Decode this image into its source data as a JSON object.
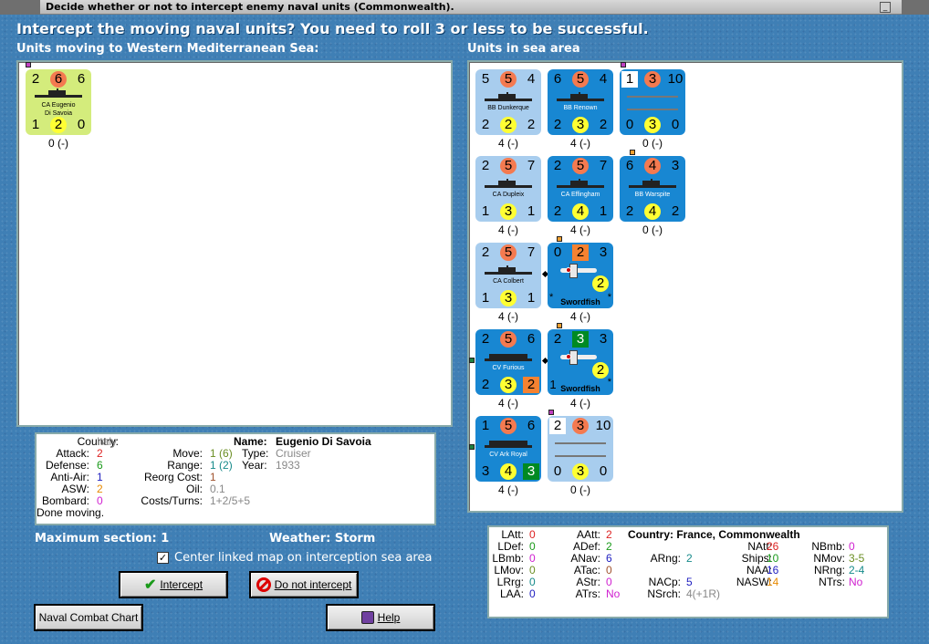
{
  "window": {
    "title": "Decide whether or not to intercept enemy naval units (Commonwealth)."
  },
  "heading": "Intercept the moving naval units?  You need to roll 3 or less to be successful.",
  "moving_label": "Units moving to Western Mediterranean Sea:",
  "sea_label": "Units in sea area",
  "moving_units": [
    {
      "name_line1": "CA Eugenio",
      "name_line2": "Di Savoia",
      "tl": "2",
      "tc": "6",
      "tr": "6",
      "bl": "1",
      "bc": "2",
      "br": "0",
      "under": "0 (-)"
    }
  ],
  "sea_units": [
    {
      "name": "BB Dunkerque",
      "tl": "5",
      "tc": "5",
      "tr": "4",
      "bl": "2",
      "bc": "2",
      "br": "2",
      "under": "4 (-)"
    },
    {
      "name": "BB Renown",
      "tl": "6",
      "tc": "5",
      "tr": "4",
      "bl": "2",
      "bc": "3",
      "br": "2",
      "under": "4 (-)"
    },
    {
      "name": "",
      "tl": "1",
      "tc": "3",
      "tr": "10",
      "bl": "0",
      "bc": "3",
      "br": "0",
      "under": "0 (-)"
    },
    {
      "name": "CA Dupleix",
      "tl": "2",
      "tc": "5",
      "tr": "7",
      "bl": "1",
      "bc": "3",
      "br": "1",
      "under": "4 (-)"
    },
    {
      "name": "CA Effingham",
      "tl": "2",
      "tc": "5",
      "tr": "7",
      "bl": "2",
      "bc": "4",
      "br": "1",
      "under": "4 (-)"
    },
    {
      "name": "BB Warspite",
      "tl": "6",
      "tc": "4",
      "tr": "3",
      "bl": "2",
      "bc": "4",
      "br": "2",
      "under": "0 (-)"
    },
    {
      "name": "CA Colbert",
      "tl": "2",
      "tc": "5",
      "tr": "7",
      "bl": "1",
      "bc": "3",
      "br": "1",
      "under": "4 (-)"
    },
    {
      "name": "Swordfish",
      "tl": "0",
      "tc": "2",
      "tr": "3",
      "mid": "2",
      "star": "*",
      "under": "4 (-)"
    },
    {
      "name": "CV Furious",
      "tl": "2",
      "tc": "5",
      "tr": "6",
      "bl": "2",
      "bc": "3",
      "br": "2",
      "under": "4 (-)"
    },
    {
      "name": "Swordfish",
      "tl": "2",
      "tc": "3",
      "tr": "3",
      "mid": "2",
      "one": "1",
      "star": "*",
      "under": "4 (-)"
    },
    {
      "name": "CV Ark Royal",
      "tl": "1",
      "tc": "5",
      "tr": "6",
      "bl": "3",
      "bc": "4",
      "br": "3",
      "under": "4 (-)"
    },
    {
      "name": "",
      "tl": "2",
      "tc": "3",
      "tr": "10",
      "bl": "0",
      "bc": "3",
      "br": "0",
      "under": "0 (-)"
    }
  ],
  "unit_info": {
    "country_label": "Country:",
    "country": "Italy",
    "attack_label": "Attack:",
    "attack": "2",
    "defense_label": "Defense:",
    "defense": "6",
    "antiair_label": "Anti-Air:",
    "antiair": "1",
    "asw_label": "ASW:",
    "asw": "2",
    "bombard_label": "Bombard:",
    "bombard": "0",
    "status": "Done moving.",
    "name_label": "Name:",
    "name": "Eugenio Di Savoia",
    "move_label": "Move:",
    "move_a": "1",
    "move_b": "(6)",
    "type_label": "Type:",
    "type": "Cruiser",
    "range_label": "Range:",
    "range_a": "1",
    "range_b": "(2)",
    "year_label": "Year:",
    "year": "1933",
    "reorg_label": "Reorg Cost:",
    "reorg": "1",
    "oil_label": "Oil:",
    "oil": "0.1",
    "cost_label": "Costs/Turns:",
    "cost": "1+2/5+5"
  },
  "max_section": "Maximum section: 1",
  "weather": "Weather:  Storm",
  "center_check": {
    "label": "Center linked map on interception sea area",
    "checked": "✓"
  },
  "buttons": {
    "intercept": "Intercept",
    "no_intercept": "Do not intercept",
    "chart": "Naval Combat Chart",
    "help": "Help"
  },
  "country_stats": {
    "title": "Country: France, Commonwealth",
    "latt_l": "LAtt:",
    "latt": "0",
    "ldef_l": "LDef:",
    "ldef": "0",
    "lbmb_l": "LBmb:",
    "lbmb": "0",
    "lmov_l": "LMov:",
    "lmov": "0",
    "lrrg_l": "LRrg:",
    "lrrg": "0",
    "laa_l": "LAA:",
    "laa": "0",
    "aatt_l": "AAtt:",
    "aatt": "2",
    "adef_l": "ADef:",
    "adef": "2",
    "anav_l": "ANav:",
    "anav": "6",
    "atac_l": "ATac:",
    "atac": "0",
    "astr_l": "AStr:",
    "astr": "0",
    "atrs_l": "ATrs:",
    "atrs": "No",
    "arng_l": "ARng:",
    "arng": "2",
    "nacp_l": "NACp:",
    "nacp": "5",
    "nsrch_l": "NSrch:",
    "nsrch": "4(+1R)",
    "natt_l": "NAtt:",
    "natt": "26",
    "ships_l": "Ships:",
    "ships": "10",
    "naa_l": "NAA:",
    "naa": "16",
    "nasw_l": "NASW:",
    "nasw": "14",
    "nbmb_l": "NBmb:",
    "nbmb": "0",
    "nmov_l": "NMov:",
    "nmov": "3-5",
    "nrng_l": "NRng:",
    "nrng": "2-4",
    "ntrs_l": "NTrs:",
    "ntrs": "No"
  }
}
